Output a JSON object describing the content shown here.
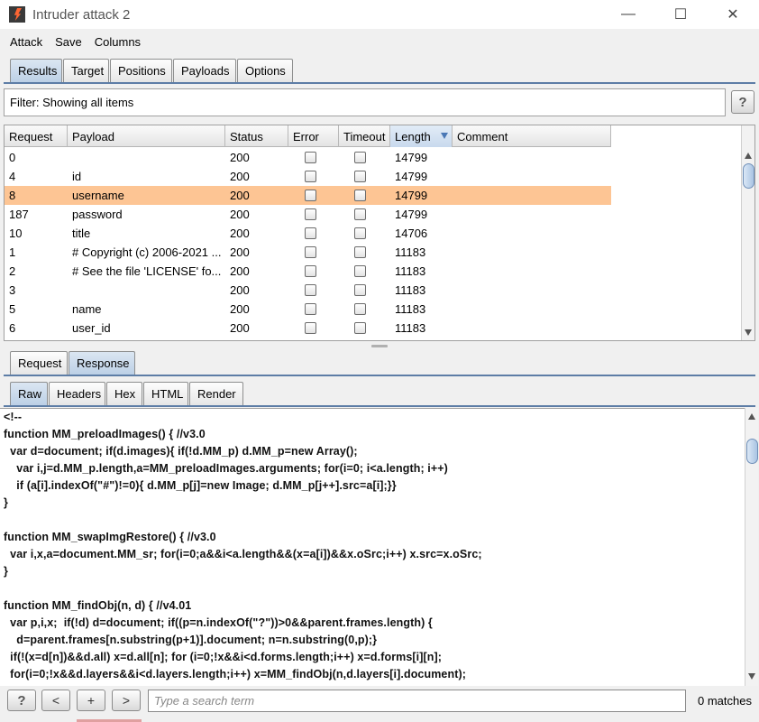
{
  "window": {
    "title": "Intruder attack 2",
    "controls": {
      "minimize": "—",
      "maximize": "☐",
      "close": "✕"
    }
  },
  "menu": [
    "Attack",
    "Save",
    "Columns"
  ],
  "main_tabs": [
    "Results",
    "Target",
    "Positions",
    "Payloads",
    "Options"
  ],
  "filter": {
    "text": "Filter: Showing all items",
    "help": "?"
  },
  "table": {
    "columns": [
      "Request",
      "Payload",
      "Status",
      "Error",
      "Timeout",
      "Length",
      "Comment"
    ],
    "sorted_column": "Length",
    "rows": [
      {
        "request": "0",
        "payload": "",
        "status": "200",
        "length": "14799",
        "selected": false
      },
      {
        "request": "4",
        "payload": "id",
        "status": "200",
        "length": "14799",
        "selected": false
      },
      {
        "request": "8",
        "payload": "username",
        "status": "200",
        "length": "14799",
        "selected": true
      },
      {
        "request": "187",
        "payload": "password",
        "status": "200",
        "length": "14799",
        "selected": false
      },
      {
        "request": "10",
        "payload": "title",
        "status": "200",
        "length": "14706",
        "selected": false
      },
      {
        "request": "1",
        "payload": "# Copyright (c) 2006-2021 ...",
        "status": "200",
        "length": "11183",
        "selected": false
      },
      {
        "request": "2",
        "payload": "# See the file 'LICENSE' fo...",
        "status": "200",
        "length": "11183",
        "selected": false
      },
      {
        "request": "3",
        "payload": "",
        "status": "200",
        "length": "11183",
        "selected": false
      },
      {
        "request": "5",
        "payload": "name",
        "status": "200",
        "length": "11183",
        "selected": false
      },
      {
        "request": "6",
        "payload": "user_id",
        "status": "200",
        "length": "11183",
        "selected": false
      }
    ]
  },
  "detail_tabs": [
    "Request",
    "Response"
  ],
  "view_tabs": [
    "Raw",
    "Headers",
    "Hex",
    "HTML",
    "Render"
  ],
  "code_lines": [
    "<!--",
    "function MM_preloadImages() { //v3.0",
    "  var d=document; if(d.images){ if(!d.MM_p) d.MM_p=new Array();",
    "    var i,j=d.MM_p.length,a=MM_preloadImages.arguments; for(i=0; i<a.length; i++)",
    "    if (a[i].indexOf(\"#\")!=0){ d.MM_p[j]=new Image; d.MM_p[j++].src=a[i];}}",
    "}",
    "",
    "function MM_swapImgRestore() { //v3.0",
    "  var i,x,a=document.MM_sr; for(i=0;a&&i<a.length&&(x=a[i])&&x.oSrc;i++) x.src=x.oSrc;",
    "}",
    "",
    "function MM_findObj(n, d) { //v4.01",
    "  var p,i,x;  if(!d) d=document; if((p=n.indexOf(\"?\"))>0&&parent.frames.length) {",
    "    d=parent.frames[n.substring(p+1)].document; n=n.substring(0,p);}",
    "  if(!(x=d[n])&&d.all) x=d.all[n]; for (i=0;!x&&i<d.forms.length;i++) x=d.forms[i][n];",
    "  for(i=0;!x&&d.layers&&i<d.layers.length;i++) x=MM_findObj(n,d.layers[i].document);"
  ],
  "search": {
    "help": "?",
    "prev": "<",
    "add": "+",
    "next": ">",
    "placeholder": "Type a search term",
    "matches": "0 matches"
  },
  "colors": {
    "selected_row": "#fdc594",
    "active_tab": "#bcd0e6",
    "accent": "#ff6633"
  }
}
